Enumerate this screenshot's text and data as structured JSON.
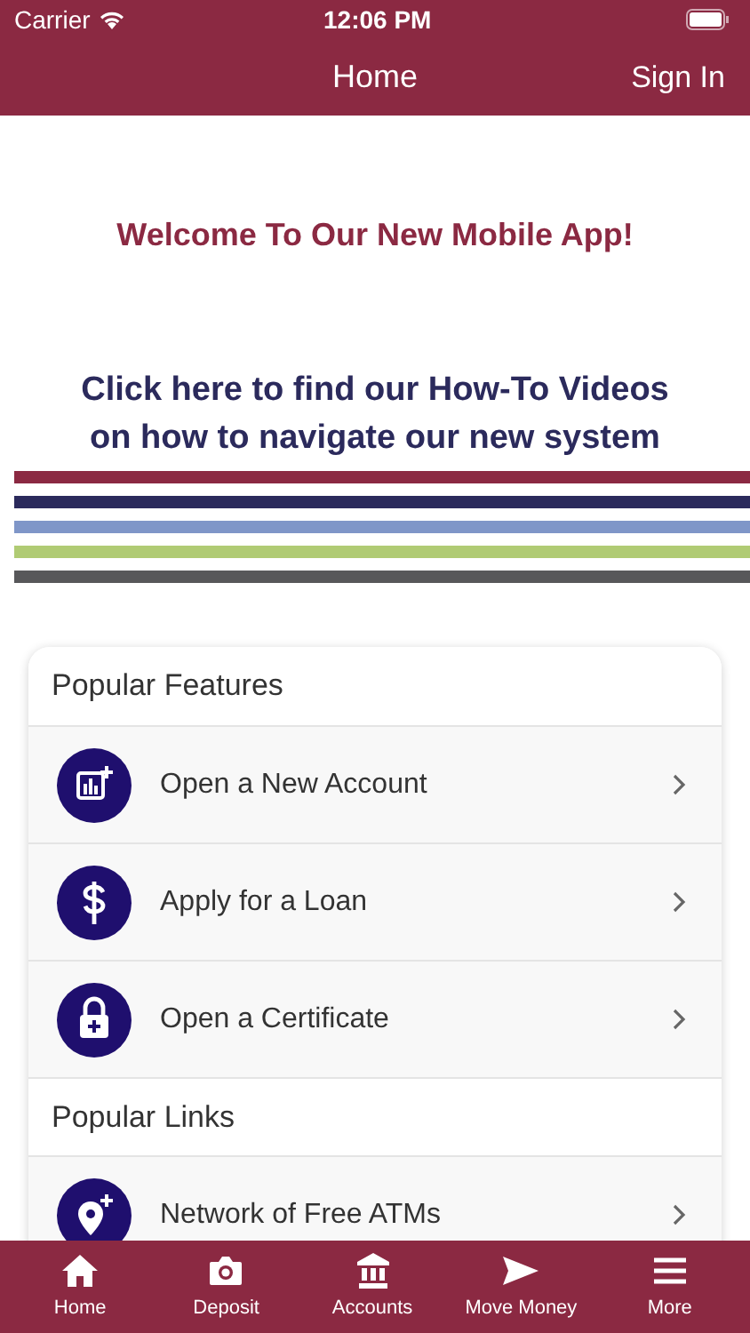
{
  "status_bar": {
    "carrier": "Carrier",
    "time": "12:06 PM"
  },
  "nav_bar": {
    "title": "Home",
    "action": "Sign In"
  },
  "banner": {
    "welcome": "Welcome To Our New Mobile App!",
    "videos_link": "Click here to find our How-To Videos on how to navigate our new system",
    "stripes": [
      {
        "color": "#8b2942"
      },
      {
        "color": "#2b2a5c"
      },
      {
        "color": "#7f96c8"
      },
      {
        "color": "#b0cb74"
      },
      {
        "color": "#58585a"
      }
    ]
  },
  "sections": [
    {
      "title": "Popular Features",
      "items": [
        {
          "label": "Open a New Account"
        },
        {
          "label": "Apply for a Loan"
        },
        {
          "label": "Open a Certificate"
        }
      ]
    },
    {
      "title": "Popular Links",
      "items": [
        {
          "label": "Network of Free ATMs"
        }
      ]
    }
  ],
  "tab_bar": [
    {
      "label": "Home"
    },
    {
      "label": "Deposit"
    },
    {
      "label": "Accounts"
    },
    {
      "label": "Move Money"
    },
    {
      "label": "More"
    }
  ]
}
